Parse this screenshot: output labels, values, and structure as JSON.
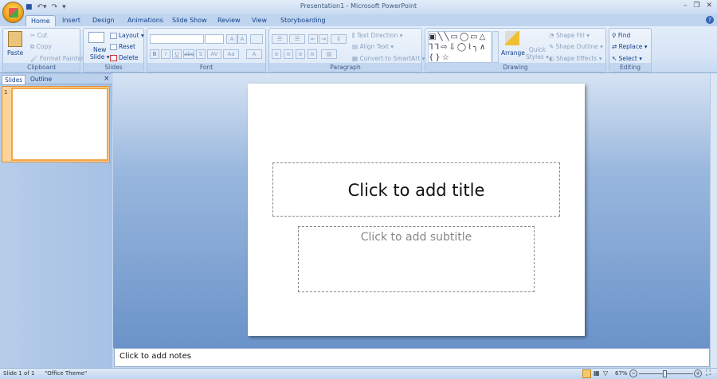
{
  "window": {
    "title": "Presentation1 - Microsoft PowerPoint",
    "controls": [
      "minimize",
      "restore",
      "close"
    ]
  },
  "quick_access": [
    "save-icon",
    "undo-icon",
    "redo-icon",
    "customize-icon"
  ],
  "tabs": [
    "Home",
    "Insert",
    "Design",
    "Animations",
    "Slide Show",
    "Review",
    "View",
    "Storyboarding"
  ],
  "active_tab": "Home",
  "ribbon": {
    "clipboard": {
      "label": "Clipboard",
      "paste": "Paste",
      "cut": "Cut",
      "copy": "Copy",
      "format_painter": "Format Painter"
    },
    "slides": {
      "label": "Slides",
      "new_slide": "New",
      "new_slide2": "Slide",
      "layout": "Layout",
      "reset": "Reset",
      "delete": "Delete"
    },
    "font": {
      "label": "Font",
      "bold": "B",
      "italic": "I",
      "underline": "U",
      "strike": "abc",
      "shadow": "S",
      "spacing": "AV",
      "case": "Aa",
      "color": "A",
      "grow": "A",
      "shrink": "A"
    },
    "paragraph": {
      "label": "Paragraph",
      "text_direction": "Text Direction",
      "align_text": "Align Text",
      "smartart": "Convert to SmartArt"
    },
    "drawing": {
      "label": "Drawing",
      "arrange": "Arrange",
      "quick_styles": "Quick",
      "quick_styles2": "Styles",
      "shape_fill": "Shape Fill",
      "shape_outline": "Shape Outline",
      "shape_effects": "Shape Effects",
      "shapes": "▣╲╲▭◯▭△⅂⅂⇨⇩◯⌇╮∧{}☆"
    },
    "editing": {
      "label": "Editing",
      "find": "Find",
      "replace": "Replace",
      "select": "Select"
    }
  },
  "left_panel": {
    "tabs": [
      "Slides",
      "Outline"
    ],
    "close": "×",
    "slide_number": "1"
  },
  "slide": {
    "title_placeholder": "Click to add title",
    "subtitle_placeholder": "Click to add subtitle"
  },
  "notes": {
    "placeholder": "Click to add notes"
  },
  "status": {
    "slide": "Slide 1 of 1",
    "theme": "\"Office Theme\"",
    "zoom": "67%",
    "zoom_minus": "−",
    "zoom_plus": "+"
  },
  "colors": {
    "accent": "#15428b",
    "ribbon": "#dce8f7",
    "workspace": "#6b93c9",
    "selection": "#f2a64a"
  }
}
